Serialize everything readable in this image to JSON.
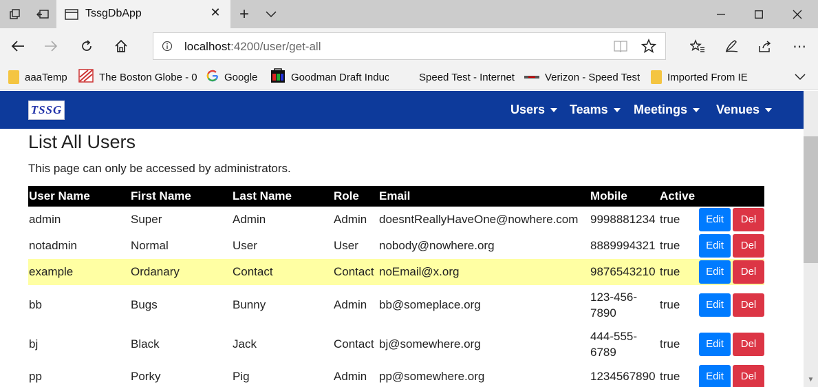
{
  "browser": {
    "tab_title": "TssgDbApp",
    "tab_close": "✕",
    "new_tab": "+",
    "url_host": "localhost",
    "url_rest": ":4200/user/get-all",
    "favorites": [
      {
        "label": "aaaTemp",
        "icon": "folder-icon"
      },
      {
        "label": "The Boston Globe - 0",
        "icon": "boston-globe-icon"
      },
      {
        "label": "Google",
        "icon": "google-icon"
      },
      {
        "label": "Goodman Draft Induc",
        "icon": "goodman-icon"
      },
      {
        "label": "Speed Test - Internet",
        "icon": ""
      },
      {
        "label": "Verizon - Speed Test",
        "icon": "verizon-icon"
      },
      {
        "label": "Imported From IE",
        "icon": "folder-icon"
      }
    ]
  },
  "app": {
    "logo_text": "TSSG",
    "menus": [
      "Users",
      "Teams",
      "Meetings",
      "Venues"
    ],
    "brand_color": "#0d3a9b"
  },
  "page": {
    "title": "List All Users",
    "description": "This page can only be accessed by administrators."
  },
  "table": {
    "headers": [
      "User Name",
      "First Name",
      "Last Name",
      "Role",
      "Email",
      "Mobile",
      "Active"
    ],
    "edit_label": "Edit",
    "del_label": "Del",
    "rows": [
      {
        "user": "admin",
        "first": "Super",
        "last": "Admin",
        "role": "Admin",
        "email": "doesntReallyHaveOne@nowhere.com",
        "mobile": "9998881234",
        "active": "true"
      },
      {
        "user": "notadmin",
        "first": "Normal",
        "last": "User",
        "role": "User",
        "email": "nobody@nowhere.org",
        "mobile": "8889994321",
        "active": "true"
      },
      {
        "user": "example",
        "first": "Ordanary",
        "last": "Contact",
        "role": "Contact",
        "email": "noEmail@x.org",
        "mobile": "9876543210",
        "active": "true"
      },
      {
        "user": "bb",
        "first": "Bugs",
        "last": "Bunny",
        "role": "Admin",
        "email": "bb@someplace.org",
        "mobile": "123-456-7890",
        "active": "true"
      },
      {
        "user": "bj",
        "first": "Black",
        "last": "Jack",
        "role": "Contact",
        "email": "bj@somewhere.org",
        "mobile": "444-555-6789",
        "active": "true"
      },
      {
        "user": "pp",
        "first": "Porky",
        "last": "Pig",
        "role": "Admin",
        "email": "pp@somewhere.org",
        "mobile": "1234567890",
        "active": "true"
      }
    ],
    "highlight_color": "#ffffa3"
  }
}
